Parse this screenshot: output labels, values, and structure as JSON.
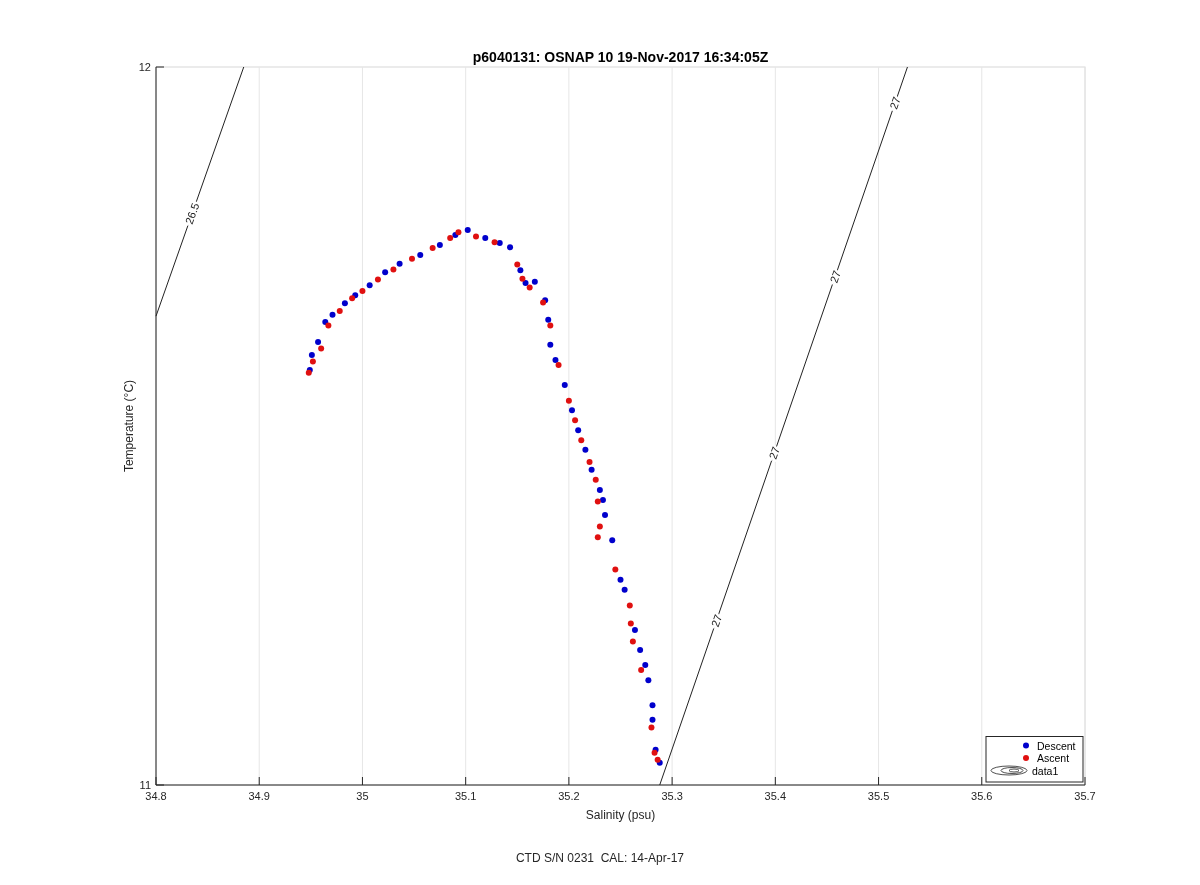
{
  "figure": {
    "chart_data": {
      "type": "scatter",
      "title": "p6040131: OSNAP 10 19-Nov-2017 16:34:05Z",
      "xlabel": "Salinity (psu)",
      "ylabel": "Temperature (°C)",
      "xlim": [
        34.8,
        35.7
      ],
      "ylim": [
        11,
        12
      ],
      "grid": true,
      "legend": true,
      "xticks": [
        {
          "value": 34.8,
          "label": "34.8"
        },
        {
          "value": 34.9,
          "label": "34.9"
        },
        {
          "value": 35,
          "label": "35"
        },
        {
          "value": 35.1,
          "label": "35.1"
        },
        {
          "value": 35.2,
          "label": "35.2"
        },
        {
          "value": 35.3,
          "label": "35.3"
        },
        {
          "value": 35.4,
          "label": "35.4"
        },
        {
          "value": 35.5,
          "label": "35.5"
        },
        {
          "value": 35.6,
          "label": "35.6"
        },
        {
          "value": 35.7,
          "label": "35.7"
        }
      ],
      "yticks": [
        {
          "value": 11,
          "label": "11"
        },
        {
          "value": 12,
          "label": "12"
        }
      ],
      "series": [
        {
          "name": "Descent",
          "color": "#0000cc",
          "x": [
            34.949,
            34.951,
            34.957,
            34.964,
            34.971,
            34.983,
            34.993,
            35.007,
            35.022,
            35.036,
            35.056,
            35.075,
            35.09,
            35.102,
            35.119,
            35.133,
            35.143,
            35.153,
            35.158,
            35.167,
            35.177,
            35.18,
            35.182,
            35.187,
            35.196,
            35.203,
            35.209,
            35.216,
            35.222,
            35.23,
            35.233,
            35.235,
            35.242,
            35.25,
            35.254,
            35.264,
            35.269,
            35.274,
            35.277,
            35.281,
            35.281,
            35.284,
            35.288
          ],
          "values": [
            11.578,
            11.599,
            11.617,
            11.645,
            11.655,
            11.671,
            11.682,
            11.696,
            11.714,
            11.726,
            11.738,
            11.752,
            11.766,
            11.773,
            11.762,
            11.755,
            11.749,
            11.717,
            11.699,
            11.701,
            11.675,
            11.648,
            11.613,
            11.592,
            11.557,
            11.522,
            11.494,
            11.467,
            11.439,
            11.411,
            11.397,
            11.376,
            11.341,
            11.286,
            11.272,
            11.216,
            11.188,
            11.167,
            11.146,
            11.111,
            11.091,
            11.049,
            11.031
          ]
        },
        {
          "name": "Ascent",
          "color": "#e01010",
          "x": [
            34.948,
            34.952,
            34.96,
            34.967,
            34.978,
            34.99,
            35,
            35.015,
            35.03,
            35.048,
            35.068,
            35.085,
            35.093,
            35.11,
            35.128,
            35.15,
            35.155,
            35.162,
            35.175,
            35.182,
            35.19,
            35.2,
            35.206,
            35.212,
            35.22,
            35.226,
            35.228,
            35.23,
            35.228,
            35.245,
            35.259,
            35.26,
            35.262,
            35.27,
            35.28,
            35.283,
            35.286
          ],
          "values": [
            11.574,
            11.59,
            11.608,
            11.64,
            11.66,
            11.678,
            11.688,
            11.704,
            11.718,
            11.733,
            11.748,
            11.762,
            11.77,
            11.764,
            11.756,
            11.725,
            11.705,
            11.693,
            11.672,
            11.64,
            11.585,
            11.535,
            11.508,
            11.48,
            11.45,
            11.425,
            11.395,
            11.36,
            11.345,
            11.3,
            11.25,
            11.225,
            11.2,
            11.16,
            11.08,
            11.045,
            11.035
          ]
        },
        {
          "name": "data1",
          "type": "line",
          "color": "#222222",
          "x": [
            34.8,
            34.885,
            null,
            35.288,
            35.528
          ],
          "values": [
            11.653,
            12,
            null,
            11,
            12
          ]
        }
      ],
      "annotations": [
        {
          "text": "26.5",
          "x": 34.835,
          "y": 11.796
        },
        {
          "text": "27",
          "x": 35.343,
          "y": 11.229
        },
        {
          "text": "27",
          "x": 35.399,
          "y": 11.4625
        },
        {
          "text": "27",
          "x": 35.458,
          "y": 11.708
        },
        {
          "text": "27",
          "x": 35.516,
          "y": 11.95
        }
      ]
    },
    "footer_note": "CTD S/N 0231  CAL: 14-Apr-17"
  }
}
